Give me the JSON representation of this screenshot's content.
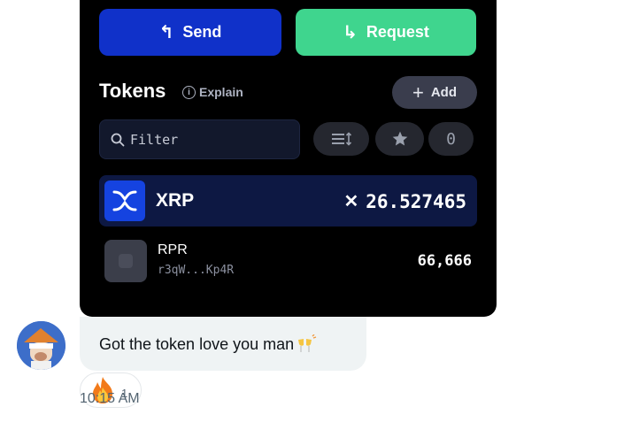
{
  "wallet": {
    "send_label": "Send",
    "request_label": "Request",
    "tokens_title": "Tokens",
    "explain_label": "Explain",
    "add_label": "Add",
    "filter_placeholder": "Filter",
    "count_value": "0",
    "tokens": [
      {
        "symbol": "XRP",
        "balance": "26.527465"
      },
      {
        "symbol": "RPR",
        "address": "r3qW...Kp4R",
        "balance": "66,666"
      }
    ]
  },
  "message": {
    "text": "Got the token love you man",
    "reaction_count": "1",
    "time": "10:15 AM"
  }
}
